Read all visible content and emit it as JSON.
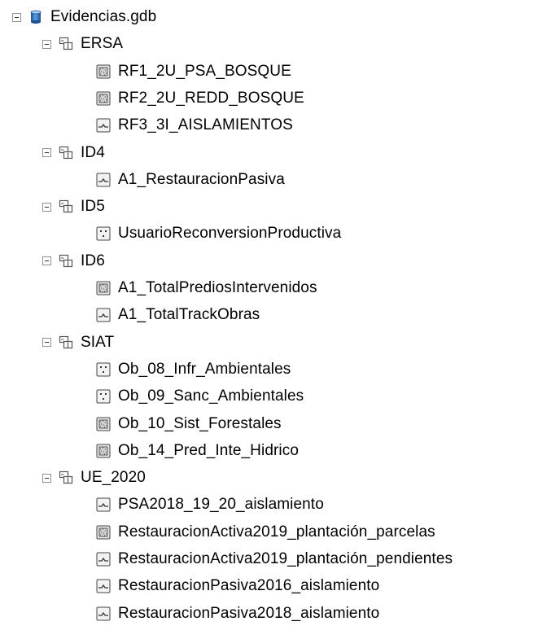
{
  "root": {
    "label": "Evidencias.gdb",
    "icon": "database-icon"
  },
  "datasets": [
    {
      "label": "ERSA",
      "icon": "feature-dataset-icon",
      "classes": [
        {
          "label": "RF1_2U_PSA_BOSQUE",
          "icon": "polygon-featureclass-icon"
        },
        {
          "label": "RF2_2U_REDD_BOSQUE",
          "icon": "polygon-featureclass-icon"
        },
        {
          "label": "RF3_3I_AISLAMIENTOS",
          "icon": "line-featureclass-icon"
        }
      ]
    },
    {
      "label": "ID4",
      "icon": "feature-dataset-icon",
      "classes": [
        {
          "label": "A1_RestauracionPasiva",
          "icon": "line-featureclass-icon"
        }
      ]
    },
    {
      "label": "ID5",
      "icon": "feature-dataset-icon",
      "classes": [
        {
          "label": "UsuarioReconversionProductiva",
          "icon": "point-featureclass-icon"
        }
      ]
    },
    {
      "label": "ID6",
      "icon": "feature-dataset-icon",
      "classes": [
        {
          "label": "A1_TotalPrediosIntervenidos",
          "icon": "polygon-featureclass-icon"
        },
        {
          "label": "A1_TotalTrackObras",
          "icon": "line-featureclass-icon"
        }
      ]
    },
    {
      "label": "SIAT",
      "icon": "feature-dataset-icon",
      "classes": [
        {
          "label": "Ob_08_Infr_Ambientales",
          "icon": "point-featureclass-icon"
        },
        {
          "label": "Ob_09_Sanc_Ambientales",
          "icon": "point-featureclass-icon"
        },
        {
          "label": "Ob_10_Sist_Forestales",
          "icon": "polygon-featureclass-icon"
        },
        {
          "label": "Ob_14_Pred_Inte_Hidrico",
          "icon": "polygon-featureclass-icon"
        }
      ]
    },
    {
      "label": "UE_2020",
      "icon": "feature-dataset-icon",
      "classes": [
        {
          "label": "PSA2018_19_20_aislamiento",
          "icon": "line-featureclass-icon"
        },
        {
          "label": "RestauracionActiva2019_plantación_parcelas",
          "icon": "polygon-featureclass-icon"
        },
        {
          "label": "RestauracionActiva2019_plantación_pendientes",
          "icon": "line-featureclass-icon"
        },
        {
          "label": "RestauracionPasiva2016_aislamiento",
          "icon": "line-featureclass-icon"
        },
        {
          "label": "RestauracionPasiva2018_aislamiento",
          "icon": "line-featureclass-icon"
        }
      ]
    }
  ]
}
